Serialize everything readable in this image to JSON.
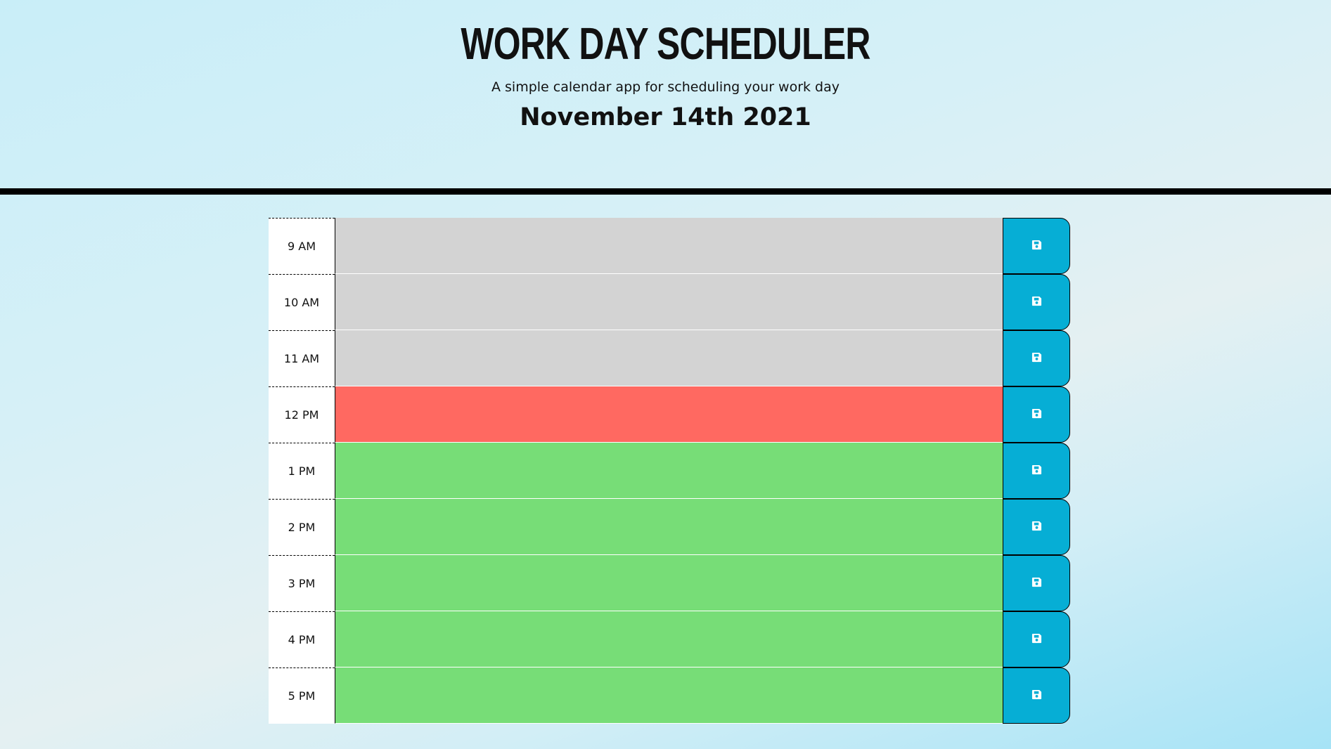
{
  "header": {
    "title": "Work Day Scheduler",
    "subtitle": "A simple calendar app for scheduling your work day",
    "current_day": "November 14th 2021"
  },
  "colors": {
    "past": "#d3d3d3",
    "present": "#ff6961",
    "future": "#77dd77",
    "save_button": "#06aed5"
  },
  "time_blocks": [
    {
      "hour": "9 AM",
      "status": "past",
      "text": ""
    },
    {
      "hour": "10 AM",
      "status": "past",
      "text": ""
    },
    {
      "hour": "11 AM",
      "status": "past",
      "text": ""
    },
    {
      "hour": "12 PM",
      "status": "present",
      "text": ""
    },
    {
      "hour": "1 PM",
      "status": "future",
      "text": ""
    },
    {
      "hour": "2 PM",
      "status": "future",
      "text": ""
    },
    {
      "hour": "3 PM",
      "status": "future",
      "text": ""
    },
    {
      "hour": "4 PM",
      "status": "future",
      "text": ""
    },
    {
      "hour": "5 PM",
      "status": "future",
      "text": ""
    }
  ],
  "icons": {
    "save": "floppy-disk-icon"
  }
}
